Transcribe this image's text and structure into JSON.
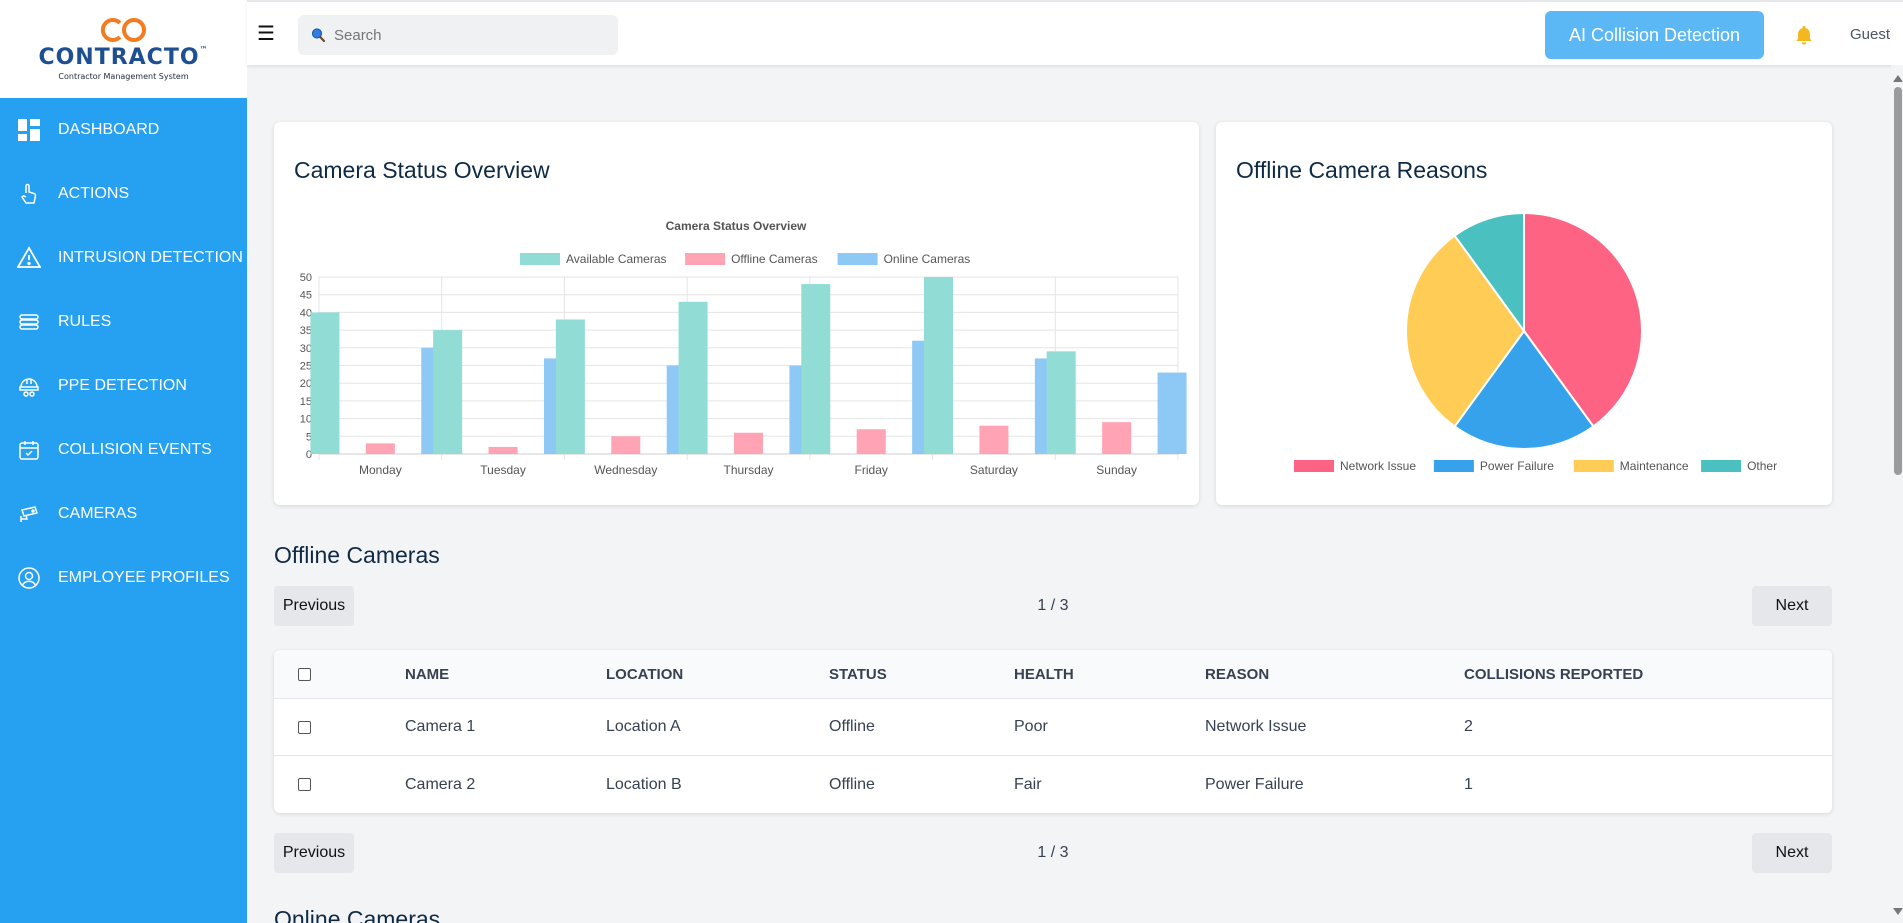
{
  "brand": {
    "name": "CONTRACTO",
    "tm": "™",
    "subtitle": "Contractor Management System",
    "color": "#1d4f91",
    "accent": "#f47b20"
  },
  "sidebar": {
    "bg": "#26a0f0",
    "items": [
      {
        "label": "DASHBOARD",
        "icon": "dashboard-icon"
      },
      {
        "label": "ACTIONS",
        "icon": "hand-pointer-icon"
      },
      {
        "label": "INTRUSION DETECTION",
        "icon": "warning-icon"
      },
      {
        "label": "RULES",
        "icon": "rules-icon"
      },
      {
        "label": "PPE DETECTION",
        "icon": "helmet-icon"
      },
      {
        "label": "COLLISION EVENTS",
        "icon": "calendar-icon"
      },
      {
        "label": "CAMERAS",
        "icon": "camera-icon"
      },
      {
        "label": "EMPLOYEE PROFILES",
        "icon": "user-circle-icon"
      }
    ]
  },
  "topbar": {
    "menu_glyph": "☰",
    "search_placeholder": "Search",
    "ai_button": "AI Collision Detection",
    "user": "Guest"
  },
  "camera_status_card": {
    "title": "Camera Status Overview"
  },
  "offline_reasons_card": {
    "title": "Offline Camera Reasons"
  },
  "chart_data": [
    {
      "type": "bar",
      "title": "Camera Status Overview",
      "categories": [
        "Monday",
        "Tuesday",
        "Wednesday",
        "Thursday",
        "Friday",
        "Saturday",
        "Sunday"
      ],
      "series": [
        {
          "name": "Available Cameras",
          "values": [
            40,
            35,
            38,
            43,
            48,
            50,
            29
          ],
          "color": "#92dcd6"
        },
        {
          "name": "Offline Cameras",
          "values": [
            3,
            2,
            5,
            6,
            7,
            8,
            9
          ],
          "color": "#ffa3b5"
        },
        {
          "name": "Online Cameras",
          "values": [
            30,
            27,
            25,
            25,
            32,
            27,
            23
          ],
          "color": "#8ec8f5"
        }
      ],
      "yticks": [
        "0",
        "5",
        "10",
        "15",
        "20",
        "25",
        "30",
        "35",
        "40",
        "45",
        "50"
      ],
      "ylim": [
        0,
        50
      ],
      "grid": true,
      "legend": "top"
    },
    {
      "type": "pie",
      "categories": [
        "Network Issue",
        "Power Failure",
        "Maintenance",
        "Other"
      ],
      "values": [
        40,
        20,
        30,
        10
      ],
      "colors": [
        "#ff6384",
        "#36a2eb",
        "#ffcd56",
        "#4bc0c0"
      ],
      "legend": "bottom"
    }
  ],
  "offline_section": {
    "title": "Offline Cameras",
    "prev": "Previous",
    "next": "Next",
    "page_info": "1 / 3",
    "columns": [
      "NAME",
      "LOCATION",
      "STATUS",
      "HEALTH",
      "REASON",
      "COLLISIONS REPORTED"
    ],
    "rows": [
      {
        "name": "Camera 1",
        "location": "Location A",
        "status": "Offline",
        "health": "Poor",
        "reason": "Network Issue",
        "collisions": "2"
      },
      {
        "name": "Camera 2",
        "location": "Location B",
        "status": "Offline",
        "health": "Fair",
        "reason": "Power Failure",
        "collisions": "1"
      }
    ]
  },
  "online_section": {
    "title": "Online Cameras"
  }
}
